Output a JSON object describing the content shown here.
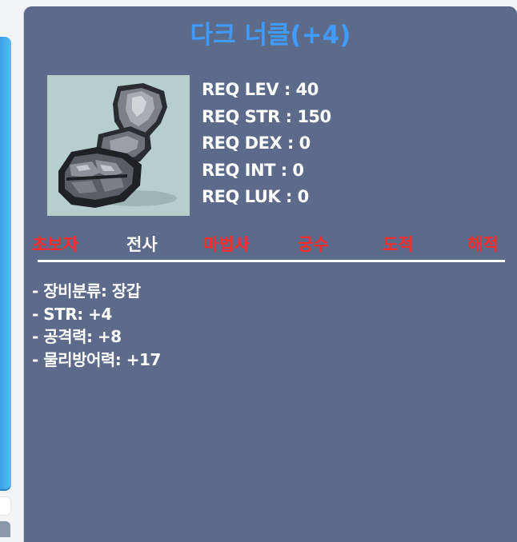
{
  "item": {
    "name": "다크 너클(+4)",
    "name_color": "#3f9bff",
    "icon": "dark-knuckle-glove-icon"
  },
  "requirements": [
    {
      "label": "REQ LEV : 40"
    },
    {
      "label": "REQ STR : 150"
    },
    {
      "label": "REQ DEX : 0"
    },
    {
      "label": "REQ INT : 0"
    },
    {
      "label": "REQ LUK : 0"
    }
  ],
  "jobs": [
    {
      "label": "초보자",
      "color": "#ff2a2a"
    },
    {
      "label": "전사",
      "color": "#ffffff"
    },
    {
      "label": "마법사",
      "color": "#ff2a2a"
    },
    {
      "label": "궁수",
      "color": "#ff2a2a"
    },
    {
      "label": "도적",
      "color": "#ff2a2a"
    },
    {
      "label": "해적",
      "color": "#ff2a2a"
    }
  ],
  "description": [
    "- 장비분류: 장갑",
    "- STR: +4",
    "- 공격력: +8",
    "- 물리방어력: +17"
  ],
  "colors": {
    "panel": "#5c6b8a",
    "accent": "#3aa0e8",
    "restricted_job": "#ff2a2a",
    "allowed_job": "#ffffff"
  }
}
